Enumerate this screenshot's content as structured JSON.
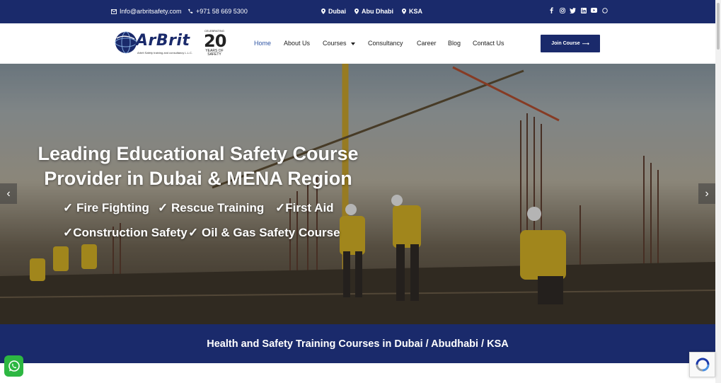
{
  "topbar": {
    "email": "Info@arbritsafety.com",
    "phone": "+971 58 669 5300",
    "locations": [
      "Dubai",
      "Abu Dhabi",
      "KSA"
    ],
    "social_icons": [
      "facebook-icon",
      "instagram-icon",
      "twitter-icon",
      "linkedin-icon",
      "youtube-icon",
      "whatsapp-icon"
    ]
  },
  "header": {
    "logo_text": "ArBrit",
    "logo_subtitle": "Arbrit Safety training and consultancy L.L.C.",
    "badge_top": "CELEBRATING",
    "badge_number": "20",
    "badge_bottom_1": "YEARS OF",
    "badge_bottom_2": "SAFETY",
    "nav": [
      "Home",
      "About Us",
      "Courses",
      "Consultancy",
      "Career",
      "Blog",
      "Contact Us"
    ],
    "active_nav": "Home",
    "join_button": "Join Course"
  },
  "hero": {
    "headline_1": "Leading Educational Safety Course",
    "headline_2": "Provider in Dubai & MENA Region",
    "bullets": [
      "✓ Fire Fighting",
      "✓ Rescue Training",
      "✓First Aid",
      "✓Construction Safety",
      "✓ Oil & Gas Safety Course"
    ]
  },
  "banner": {
    "text": "Health and Safety Training Courses in Dubai / Abudhabi / KSA"
  },
  "colors": {
    "brand_navy": "#1a2a6b",
    "nav_active": "#2f55a4",
    "whatsapp_green": "#2db742"
  }
}
